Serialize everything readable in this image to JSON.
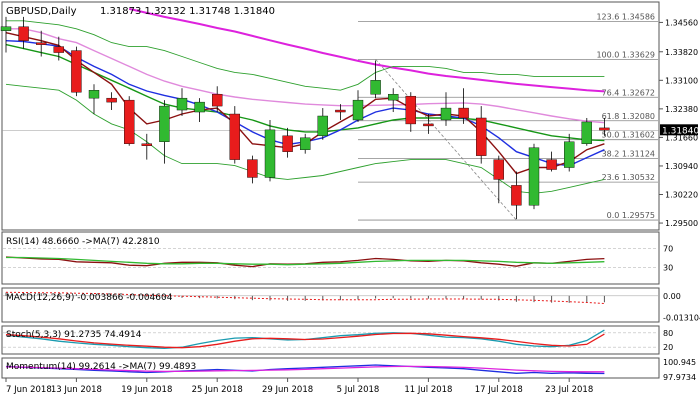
{
  "header": {
    "symbol": "GBPUSD,Daily",
    "ohlc": "1.31873 1.32132 1.31748 1.31840"
  },
  "price_badge": "1.31840",
  "colors": {
    "bull": "#31b931",
    "bear": "#e81c1c",
    "ma_magenta": "#dd22dd",
    "ma_pink": "#e08adc",
    "ma_blue": "#1f2fe0",
    "ma_maroon": "#8b1010",
    "ma_green": "#169616",
    "band": "#2ea02e",
    "fib": "#888888",
    "badge_bg": "#000000",
    "badge_fg": "#ffffff"
  },
  "chart_data": [
    {
      "type": "candlestick",
      "panel": "price",
      "ylim": [
        1.2935,
        1.3505
      ],
      "y_ticks": [
        "1.34560",
        "1.33820",
        "1.33100",
        "1.32380",
        "1.31660",
        "1.30940",
        "1.30220",
        "1.29500"
      ],
      "x_labels": [
        {
          "i": 0,
          "label": "7 Jun 2018"
        },
        {
          "i": 4,
          "label": "13 Jun 2018"
        },
        {
          "i": 8,
          "label": "19 Jun 2018"
        },
        {
          "i": 12,
          "label": "25 Jun 2018"
        },
        {
          "i": 16,
          "label": "29 Jun 2018"
        },
        {
          "i": 20,
          "label": "5 Jul 2018"
        },
        {
          "i": 24,
          "label": "11 Jul 2018"
        },
        {
          "i": 28,
          "label": "17 Jul 2018"
        },
        {
          "i": 32,
          "label": "23 Jul 2018"
        }
      ],
      "candles": [
        {
          "o": 1.3435,
          "h": 1.347,
          "l": 1.338,
          "c": 1.3445
        },
        {
          "o": 1.3445,
          "h": 1.347,
          "l": 1.339,
          "c": 1.341
        },
        {
          "o": 1.3405,
          "h": 1.3435,
          "l": 1.337,
          "c": 1.34
        },
        {
          "o": 1.3395,
          "h": 1.342,
          "l": 1.336,
          "c": 1.338
        },
        {
          "o": 1.3385,
          "h": 1.3395,
          "l": 1.327,
          "c": 1.328
        },
        {
          "o": 1.3265,
          "h": 1.33,
          "l": 1.3225,
          "c": 1.3285
        },
        {
          "o": 1.3265,
          "h": 1.328,
          "l": 1.3235,
          "c": 1.3255
        },
        {
          "o": 1.326,
          "h": 1.327,
          "l": 1.3145,
          "c": 1.315
        },
        {
          "o": 1.315,
          "h": 1.3175,
          "l": 1.311,
          "c": 1.3145
        },
        {
          "o": 1.3155,
          "h": 1.326,
          "l": 1.31,
          "c": 1.3245
        },
        {
          "o": 1.3235,
          "h": 1.329,
          "l": 1.322,
          "c": 1.3265
        },
        {
          "o": 1.323,
          "h": 1.3265,
          "l": 1.3205,
          "c": 1.3255
        },
        {
          "o": 1.3275,
          "h": 1.3295,
          "l": 1.323,
          "c": 1.3245
        },
        {
          "o": 1.3225,
          "h": 1.3245,
          "l": 1.31,
          "c": 1.311
        },
        {
          "o": 1.311,
          "h": 1.312,
          "l": 1.305,
          "c": 1.3065
        },
        {
          "o": 1.3065,
          "h": 1.321,
          "l": 1.3055,
          "c": 1.3185
        },
        {
          "o": 1.317,
          "h": 1.319,
          "l": 1.3115,
          "c": 1.313
        },
        {
          "o": 1.3135,
          "h": 1.3175,
          "l": 1.3125,
          "c": 1.3165
        },
        {
          "o": 1.317,
          "h": 1.324,
          "l": 1.316,
          "c": 1.322
        },
        {
          "o": 1.3235,
          "h": 1.325,
          "l": 1.321,
          "c": 1.323
        },
        {
          "o": 1.321,
          "h": 1.3285,
          "l": 1.3205,
          "c": 1.326
        },
        {
          "o": 1.3275,
          "h": 1.336,
          "l": 1.3265,
          "c": 1.331
        },
        {
          "o": 1.326,
          "h": 1.329,
          "l": 1.323,
          "c": 1.3275
        },
        {
          "o": 1.327,
          "h": 1.328,
          "l": 1.318,
          "c": 1.32
        },
        {
          "o": 1.32,
          "h": 1.3225,
          "l": 1.3175,
          "c": 1.3195
        },
        {
          "o": 1.321,
          "h": 1.328,
          "l": 1.3195,
          "c": 1.324
        },
        {
          "o": 1.324,
          "h": 1.329,
          "l": 1.32,
          "c": 1.3215
        },
        {
          "o": 1.3215,
          "h": 1.3245,
          "l": 1.31,
          "c": 1.312
        },
        {
          "o": 1.311,
          "h": 1.312,
          "l": 1.3,
          "c": 1.306
        },
        {
          "o": 1.3045,
          "h": 1.308,
          "l": 1.296,
          "c": 1.2995
        },
        {
          "o": 1.2995,
          "h": 1.315,
          "l": 1.2985,
          "c": 1.314
        },
        {
          "o": 1.311,
          "h": 1.313,
          "l": 1.308,
          "c": 1.3085
        },
        {
          "o": 1.309,
          "h": 1.3175,
          "l": 1.308,
          "c": 1.3155
        },
        {
          "o": 1.315,
          "h": 1.3215,
          "l": 1.3145,
          "c": 1.3205
        },
        {
          "o": 1.319,
          "h": 1.3215,
          "l": 1.317,
          "c": 1.3184
        }
      ],
      "moving_averages": [
        {
          "color": "ma_magenta",
          "values": [
            null,
            null,
            null,
            null,
            null,
            null,
            null,
            1.349,
            1.348,
            1.347,
            1.3461,
            1.3452,
            1.3442,
            1.3433,
            1.3422,
            1.3411,
            1.34,
            1.339,
            1.3379,
            1.3369,
            1.3359,
            1.335,
            1.3342,
            1.3335,
            1.3327,
            1.3321,
            1.3316,
            1.3311,
            1.3306,
            1.3301,
            1.3297,
            1.3293,
            1.3289,
            1.3285,
            1.3282
          ]
        },
        {
          "color": "ma_pink",
          "values": [
            1.344,
            1.344,
            1.343,
            1.3415,
            1.3405,
            1.3385,
            1.3365,
            1.3345,
            1.3325,
            1.3308,
            1.3295,
            1.3285,
            1.3275,
            1.3268,
            1.3262,
            1.3258,
            1.3254,
            1.325,
            1.3248,
            1.3246,
            1.3246,
            1.3247,
            1.3248,
            1.3249,
            1.3251,
            1.3252,
            1.3253,
            1.325,
            1.3244,
            1.3236,
            1.3228,
            1.322,
            1.3213,
            1.3207,
            1.3203
          ]
        },
        {
          "color": "ma_green",
          "values": [
            1.34,
            1.339,
            1.338,
            1.337,
            1.335,
            1.333,
            1.331,
            1.329,
            1.327,
            1.325,
            1.324,
            1.3235,
            1.323,
            1.322,
            1.321,
            1.3195,
            1.3185,
            1.318,
            1.318,
            1.3185,
            1.319,
            1.32,
            1.321,
            1.3215,
            1.3215,
            1.3215,
            1.3214,
            1.321,
            1.32,
            1.319,
            1.318,
            1.317,
            1.3165,
            1.316,
            1.3158
          ]
        },
        {
          "color": "ma_blue",
          "values": [
            1.341,
            1.3408,
            1.3402,
            1.3396,
            1.3368,
            1.3345,
            1.3325,
            1.33,
            1.3283,
            1.3272,
            1.3262,
            1.3248,
            1.323,
            1.3205,
            1.318,
            1.316,
            1.3148,
            1.3155,
            1.3165,
            1.3185,
            1.321,
            1.323,
            1.324,
            1.3235,
            1.3225,
            1.322,
            1.3215,
            1.3195,
            1.3165,
            1.313,
            1.3115,
            1.31,
            1.3095,
            1.3115,
            1.3135
          ]
        },
        {
          "color": "ma_maroon",
          "values": [
            1.343,
            1.342,
            1.341,
            1.3398,
            1.336,
            1.333,
            1.33,
            1.324,
            1.32,
            1.321,
            1.3225,
            1.3235,
            1.324,
            1.32,
            1.315,
            1.3145,
            1.314,
            1.315,
            1.318,
            1.3205,
            1.323,
            1.3262,
            1.3265,
            1.324,
            1.322,
            1.3225,
            1.322,
            1.318,
            1.313,
            1.3075,
            1.309,
            1.309,
            1.3105,
            1.3135,
            1.315
          ]
        },
        {
          "color": "band",
          "values": [
            1.346,
            1.346,
            1.3455,
            1.345,
            1.344,
            1.3425,
            1.3405,
            1.3395,
            1.3395,
            1.3385,
            1.337,
            1.3355,
            1.334,
            1.333,
            1.3325,
            1.3315,
            1.3305,
            1.3295,
            1.329,
            1.3285,
            1.33,
            1.333,
            1.3345,
            1.3345,
            1.3345,
            1.334,
            1.333,
            1.333,
            1.3325,
            1.3325,
            1.332,
            1.332,
            1.332,
            1.332,
            1.332
          ]
        },
        {
          "color": "band",
          "values": [
            1.33,
            1.3295,
            1.329,
            1.3285,
            1.326,
            1.3225,
            1.32,
            1.3185,
            1.3155,
            1.312,
            1.31,
            1.31,
            1.31,
            1.3095,
            1.308,
            1.3065,
            1.306,
            1.3065,
            1.307,
            1.308,
            1.309,
            1.31,
            1.3105,
            1.311,
            1.311,
            1.311,
            1.31,
            1.309,
            1.306,
            1.303,
            1.3025,
            1.303,
            1.304,
            1.305,
            1.306
          ]
        }
      ],
      "fib_levels": [
        {
          "label": "123.6 1.34586",
          "value": 1.34586
        },
        {
          "label": "100.0 1.33629",
          "value": 1.33629
        },
        {
          "label": "76.4 1.32672",
          "value": 1.32672
        },
        {
          "label": "61.8 1.32080",
          "value": 1.3208
        },
        {
          "label": "50.0 1.31602",
          "value": 1.31602
        },
        {
          "label": "38.2 1.31124",
          "value": 1.31124
        },
        {
          "label": "23.6 1.30532",
          "value": 1.30532
        },
        {
          "label": "0.0 1.29575",
          "value": 1.29575
        }
      ],
      "fib_trend": {
        "from": {
          "i": 21,
          "v": 1.33629
        },
        "to": {
          "i": 29,
          "v": 1.29575
        }
      }
    },
    {
      "type": "line",
      "panel": "rsi",
      "title": "RSI(14) 48.6660 ->MA(7) 42.2810",
      "ylim": [
        0,
        100
      ],
      "y_ticks": [
        "70",
        "30"
      ],
      "levels": [
        70,
        30
      ],
      "series": [
        {
          "color": "#8b1010",
          "values": [
            52,
            50,
            48,
            47,
            42,
            41,
            40,
            35,
            34,
            39,
            41,
            41,
            40,
            35,
            32,
            38,
            37,
            38,
            41,
            42,
            45,
            49,
            47,
            44,
            43,
            45,
            44,
            40,
            37,
            33,
            40,
            39,
            43,
            47,
            48.67
          ]
        },
        {
          "color": "#31b931",
          "values": [
            51,
            51,
            50,
            49,
            47,
            45,
            43,
            41,
            39,
            38,
            38,
            39,
            39,
            38,
            37,
            37,
            36,
            37,
            38,
            39,
            41,
            43,
            44,
            45,
            45,
            45,
            45,
            44,
            43,
            41,
            40,
            39,
            40,
            41,
            42.28
          ]
        }
      ]
    },
    {
      "type": "bar",
      "panel": "macd",
      "title": "MACD(12,26,9) -0.003866 -0.004604",
      "ylim": [
        -0.0145,
        0.0035
      ],
      "y_ticks": [
        "0.00",
        "-0.013104"
      ],
      "values": [
        0.002,
        0.0018,
        0.0016,
        0.0014,
        0.001,
        0.0006,
        0.0003,
        -0.0003,
        -0.0008,
        -0.001,
        -0.0012,
        -0.0014,
        -0.0016,
        -0.002,
        -0.0026,
        -0.0028,
        -0.003,
        -0.003,
        -0.0028,
        -0.0026,
        -0.0022,
        -0.0016,
        -0.0014,
        -0.0015,
        -0.0017,
        -0.0017,
        -0.0018,
        -0.0022,
        -0.0028,
        -0.0036,
        -0.0038,
        -0.0041,
        -0.0042,
        -0.004,
        -0.003866
      ],
      "signal": [
        0.0021,
        0.002,
        0.0019,
        0.0018,
        0.0016,
        0.0014,
        0.0011,
        0.0008,
        0.0004,
        0.0001,
        -0.0002,
        -0.0005,
        -0.0008,
        -0.0011,
        -0.0014,
        -0.0017,
        -0.0019,
        -0.0021,
        -0.0023,
        -0.0024,
        -0.0024,
        -0.0023,
        -0.0021,
        -0.002,
        -0.0019,
        -0.0019,
        -0.0019,
        -0.002,
        -0.0021,
        -0.0024,
        -0.0027,
        -0.0031,
        -0.0035,
        -0.004,
        -0.004604
      ]
    },
    {
      "type": "line",
      "panel": "stoch",
      "title": "Stoch(5,3,3) 91.2735 74.4914",
      "ylim": [
        0,
        100
      ],
      "y_ticks": [
        "80",
        "20"
      ],
      "levels": [
        80,
        20
      ],
      "series": [
        {
          "color": "#1a9bb0",
          "values": [
            70,
            62,
            55,
            45,
            38,
            32,
            28,
            22,
            18,
            15,
            20,
            35,
            48,
            58,
            60,
            55,
            50,
            52,
            60,
            68,
            72,
            78,
            80,
            78,
            70,
            62,
            60,
            55,
            45,
            32,
            25,
            22,
            28,
            48,
            91.27
          ]
        },
        {
          "color": "#e81c1c",
          "values": [
            72,
            68,
            62,
            55,
            46,
            38,
            33,
            28,
            24,
            20,
            18,
            22,
            32,
            45,
            55,
            57,
            55,
            52,
            54,
            60,
            66,
            73,
            77,
            78,
            76,
            70,
            64,
            59,
            53,
            44,
            35,
            28,
            25,
            32,
            74.49
          ]
        }
      ]
    },
    {
      "type": "line",
      "panel": "momentum",
      "title": "Momentum(14) 99.2614 ->MA(7) 99.4893",
      "ylim": [
        98.8,
        101.2
      ],
      "y_ticks": [
        "100.945",
        "97.9734"
      ],
      "series": [
        {
          "color": "#1f2fe0",
          "values": [
            100.2,
            100.1,
            100.0,
            99.9,
            99.8,
            99.7,
            99.6,
            99.5,
            99.4,
            99.5,
            99.6,
            99.7,
            99.8,
            99.7,
            99.6,
            99.8,
            99.9,
            100.0,
            100.1,
            100.2,
            100.3,
            100.4,
            100.3,
            100.2,
            100.1,
            100.0,
            99.9,
            99.7,
            99.5,
            99.3,
            99.4,
            99.3,
            99.35,
            99.3,
            99.26
          ]
        },
        {
          "color": "#dd22dd",
          "values": [
            100.15,
            100.12,
            100.05,
            99.98,
            99.9,
            99.82,
            99.74,
            99.66,
            99.58,
            99.55,
            99.55,
            99.58,
            99.62,
            99.66,
            99.68,
            99.72,
            99.76,
            99.82,
            99.9,
            99.98,
            100.06,
            100.14,
            100.2,
            100.22,
            100.2,
            100.15,
            100.08,
            99.98,
            99.85,
            99.72,
            99.62,
            99.55,
            99.51,
            99.49,
            99.49
          ]
        }
      ]
    }
  ]
}
